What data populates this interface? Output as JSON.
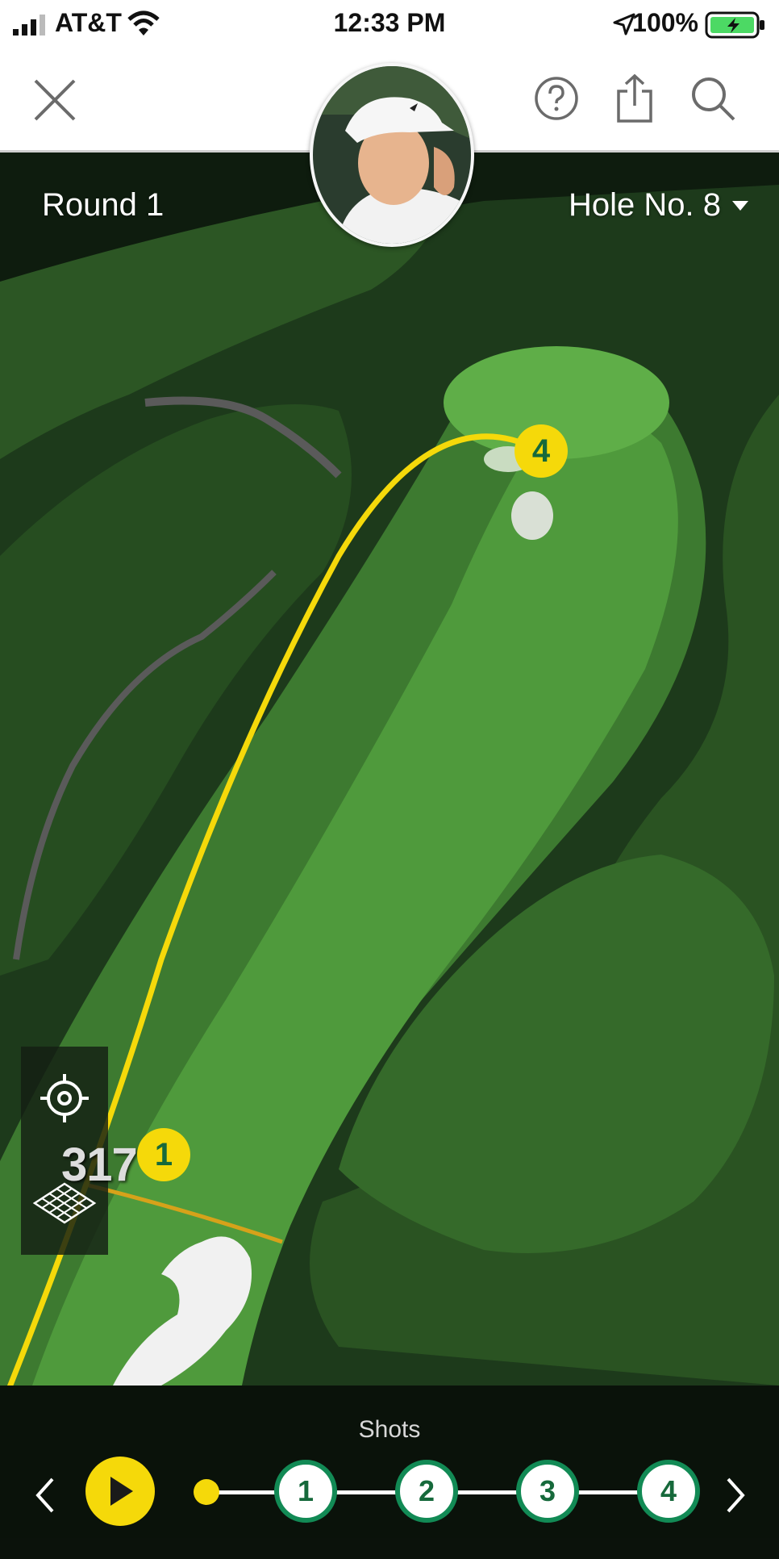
{
  "status_bar": {
    "carrier": "AT&T",
    "time": "12:33 PM",
    "battery": "100%"
  },
  "header": {
    "close_icon": "close-icon",
    "help_icon": "question-circle-icon",
    "share_icon": "share-icon",
    "search_icon": "search-icon"
  },
  "map": {
    "round_label": "Round 1",
    "hole_label": "Hole No. 8",
    "distance": "317",
    "shot_markers": [
      "1",
      "4"
    ]
  },
  "shots": {
    "title": "Shots",
    "steps": [
      "1",
      "2",
      "3",
      "4"
    ]
  },
  "colors": {
    "accent": "#f5d90a",
    "step_border": "#128a55",
    "step_text": "#16693b"
  }
}
